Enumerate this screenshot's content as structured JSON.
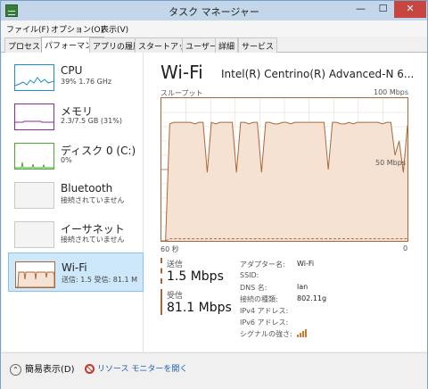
{
  "window": {
    "title": "タスク マネージャー",
    "minimize": "—",
    "maximize": "☐",
    "close": "✕"
  },
  "menu": [
    "ファイル(F)",
    "オプション(O)",
    "表示(V)"
  ],
  "tabs": [
    "プロセス",
    "パフォーマンス",
    "アプリの履歴",
    "スタートアップ",
    "ユーザー",
    "詳細",
    "サービス"
  ],
  "sidebar": {
    "items": [
      {
        "name": "CPU",
        "sub": "39% 1.76 GHz",
        "color": "#1f8bd1"
      },
      {
        "name": "メモリ",
        "sub": "2.3/7.5 GB (31%)",
        "color": "#8b2a9e"
      },
      {
        "name": "ディスク 0 (C:)",
        "sub": "0%",
        "color": "#4aa832"
      },
      {
        "name": "Bluetooth",
        "sub": "接続されていません",
        "color": "#a9683b"
      },
      {
        "name": "イーサネット",
        "sub": "接続されていません",
        "color": "#a9683b"
      },
      {
        "name": "Wi-Fi",
        "sub": "送信: 1.5 受信: 81.1 M",
        "color": "#a9683b"
      }
    ]
  },
  "main": {
    "title": "Wi-Fi",
    "device": "Intel(R) Centrino(R) Advanced-N 6...",
    "graph_label": "スループット",
    "max_label": "100 Mbps",
    "mid_label": "50 Mbps",
    "time_label": "60 秒",
    "zero_label": "0",
    "send_label": "送信",
    "send_value": "1.5 Mbps",
    "recv_label": "受信",
    "recv_value": "81.1 Mbps",
    "props": [
      {
        "label": "アダプター名:",
        "value": "Wi-Fi"
      },
      {
        "label": "SSID:",
        "value": ""
      },
      {
        "label": "DNS 名:",
        "value": "lan"
      },
      {
        "label": "接続の種類:",
        "value": "802.11g"
      },
      {
        "label": "IPv4 アドレス:",
        "value": ""
      },
      {
        "label": "IPv6 アドレス:",
        "value": ""
      },
      {
        "label": "シグナルの強さ:",
        "value": ""
      }
    ]
  },
  "footer": {
    "fewer": "簡易表示(D)",
    "resmon": "リソース モニターを開く"
  },
  "chart_data": {
    "type": "area",
    "ylim": [
      0,
      100
    ],
    "series": [
      {
        "name": "受信",
        "values": [
          0,
          0,
          82,
          83,
          83,
          83,
          83,
          83,
          82,
          83,
          83,
          48,
          83,
          82,
          83,
          83,
          83,
          83,
          48,
          83,
          83,
          82,
          83,
          83,
          48,
          83,
          83,
          82,
          82,
          83,
          83,
          82,
          83,
          83,
          83,
          83,
          83,
          83,
          83,
          83,
          50,
          83,
          83,
          82,
          82,
          83,
          82,
          83,
          83,
          83,
          83,
          83,
          83,
          82,
          83,
          83,
          60,
          70,
          48,
          81
        ]
      },
      {
        "name": "送信",
        "values": [
          0,
          0,
          1.5,
          1.5,
          1.5,
          1.5,
          1.5,
          1.5,
          1.5,
          1.5,
          1.5,
          1.5,
          1.5,
          1.5,
          1.5,
          1.5,
          1.5,
          1.5,
          1.5,
          1.5,
          1.5,
          1.5,
          1.5,
          1.5,
          1.5,
          1.5,
          1.5,
          1.5,
          1.5,
          1.5,
          1.5,
          1.5,
          1.5,
          1.5,
          1.5,
          1.5,
          1.5,
          1.5,
          1.5,
          1.5,
          1.5,
          1.5,
          1.5,
          1.5,
          1.5,
          1.5,
          1.5,
          1.5,
          1.5,
          1.5,
          1.5,
          1.5,
          1.5,
          1.5,
          1.5,
          1.5,
          1.5,
          1.5,
          1.5,
          1.5
        ]
      }
    ]
  }
}
